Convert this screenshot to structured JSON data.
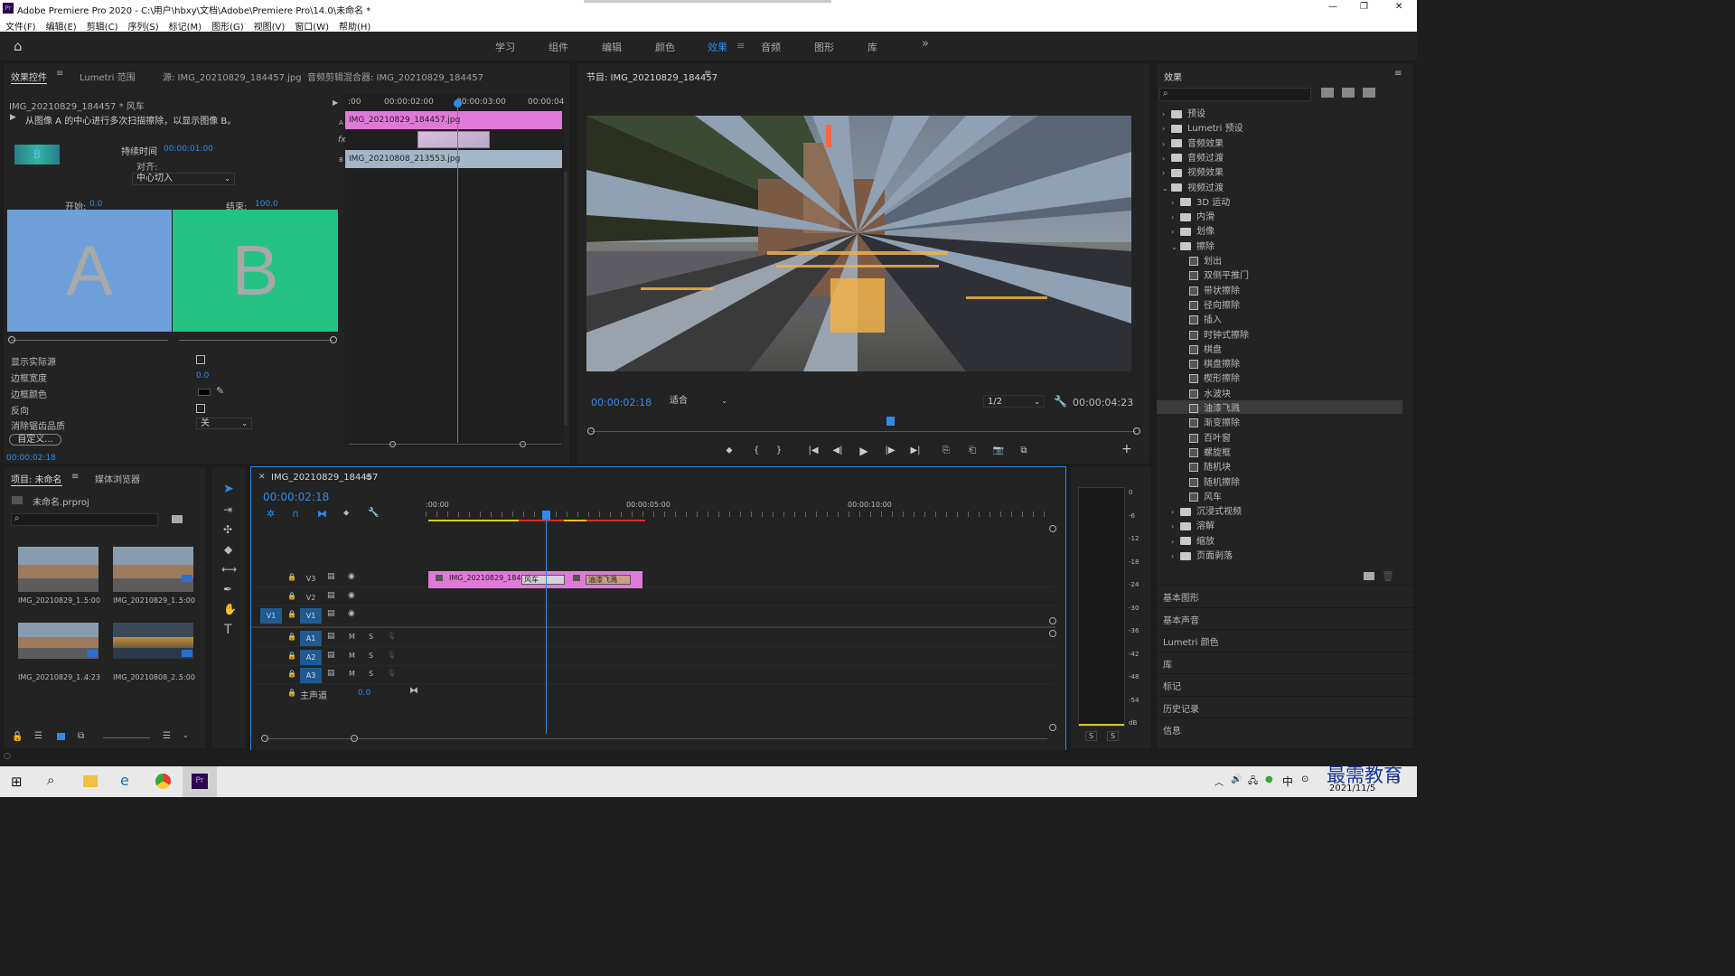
{
  "app": {
    "title": "Adobe Premiere Pro 2020 - C:\\用户\\hbxy\\文档\\Adobe\\Premiere Pro\\14.0\\未命名 *",
    "window_controls": [
      "—",
      "❐",
      "✕"
    ]
  },
  "menu": [
    "文件(F)",
    "编辑(E)",
    "剪辑(C)",
    "序列(S)",
    "标记(M)",
    "图形(G)",
    "视图(V)",
    "窗口(W)",
    "帮助(H)"
  ],
  "workspaces": {
    "tabs": [
      "学习",
      "组件",
      "编辑",
      "颜色",
      "效果",
      "音频",
      "图形",
      "库"
    ],
    "active": "效果",
    "more": "»"
  },
  "effect_controls": {
    "tabs": [
      "效果控件",
      "Lumetri 范围",
      "源: IMG_20210829_184457.jpg",
      "音频剪辑混合器: IMG_20210829_184457"
    ],
    "clip_label": "IMG_20210829_184457 * 风车",
    "description": "从图像 A 的中心进行多次扫描擦除，以显示图像 B。",
    "duration_label": "持续时间",
    "duration_value": "00:00:01:00",
    "align_label": "对齐:",
    "align_value": "中心切入",
    "start_label": "开始:",
    "start_value": "0.0",
    "end_label": "结束:",
    "end_value": "100.0",
    "preview_a": "A",
    "preview_b": "B",
    "thumb_label": "B",
    "props": [
      {
        "label": "显示实际源",
        "type": "checkbox"
      },
      {
        "label": "边框宽度",
        "value": "0.0"
      },
      {
        "label": "边框颜色",
        "type": "color"
      },
      {
        "label": "反向",
        "type": "checkbox"
      },
      {
        "label": "消除锯齿品质",
        "value": "关"
      }
    ],
    "custom_button": "自定义...",
    "timecode": "00:00:02:18",
    "mini_timeline": {
      "ruler": [
        ":00",
        "00:00:02:00",
        "00:00:03:00",
        "00:00:04"
      ],
      "clip_a": "IMG_20210829_184457.jpg",
      "clip_b": "IMG_20210808_213553.jpg",
      "track_a": "A",
      "track_b": "B",
      "fx": "fx"
    }
  },
  "program": {
    "title": "节目: IMG_20210829_184457",
    "timecode": "00:00:02:18",
    "fit": "适合",
    "resolution": "1/2",
    "duration": "00:00:04:23",
    "controls": [
      "⬥",
      "{",
      "}",
      "|◀",
      "◀|",
      "▶",
      "|▶",
      "▶|",
      "⎘",
      "⎗",
      "📷",
      "⧉"
    ],
    "add": "+"
  },
  "effects": {
    "title": "效果",
    "search_placeholder": "",
    "tree": [
      {
        "label": "预设",
        "kind": "folder",
        "level": 0,
        "caret": "›"
      },
      {
        "label": "Lumetri 预设",
        "kind": "folder",
        "level": 0,
        "caret": "›"
      },
      {
        "label": "音频效果",
        "kind": "folder",
        "level": 0,
        "caret": "›"
      },
      {
        "label": "音频过渡",
        "kind": "folder",
        "level": 0,
        "caret": "›"
      },
      {
        "label": "视频效果",
        "kind": "folder",
        "level": 0,
        "caret": "›"
      },
      {
        "label": "视频过渡",
        "kind": "folder",
        "level": 0,
        "caret": "⌄"
      },
      {
        "label": "3D 运动",
        "kind": "folder",
        "level": 1,
        "caret": "›"
      },
      {
        "label": "内滑",
        "kind": "folder",
        "level": 1,
        "caret": "›"
      },
      {
        "label": "划像",
        "kind": "folder",
        "level": 1,
        "caret": "›"
      },
      {
        "label": "擦除",
        "kind": "folder",
        "level": 1,
        "caret": "⌄"
      },
      {
        "label": "划出",
        "kind": "fx",
        "level": 2
      },
      {
        "label": "双侧平推门",
        "kind": "fx",
        "level": 2
      },
      {
        "label": "带状擦除",
        "kind": "fx",
        "level": 2
      },
      {
        "label": "径向擦除",
        "kind": "fx",
        "level": 2
      },
      {
        "label": "插入",
        "kind": "fx",
        "level": 2
      },
      {
        "label": "时钟式擦除",
        "kind": "fx",
        "level": 2
      },
      {
        "label": "棋盘",
        "kind": "fx",
        "level": 2
      },
      {
        "label": "棋盘擦除",
        "kind": "fx",
        "level": 2
      },
      {
        "label": "楔形擦除",
        "kind": "fx",
        "level": 2
      },
      {
        "label": "水波块",
        "kind": "fx",
        "level": 2
      },
      {
        "label": "油漆飞溅",
        "kind": "fx",
        "level": 2,
        "selected": true
      },
      {
        "label": "渐变擦除",
        "kind": "fx",
        "level": 2
      },
      {
        "label": "百叶窗",
        "kind": "fx",
        "level": 2
      },
      {
        "label": "螺旋框",
        "kind": "fx",
        "level": 2
      },
      {
        "label": "随机块",
        "kind": "fx",
        "level": 2
      },
      {
        "label": "随机擦除",
        "kind": "fx",
        "level": 2
      },
      {
        "label": "风车",
        "kind": "fx",
        "level": 2
      },
      {
        "label": "沉浸式视频",
        "kind": "folder",
        "level": 1,
        "caret": "›"
      },
      {
        "label": "溶解",
        "kind": "folder",
        "level": 1,
        "caret": "›"
      },
      {
        "label": "缩放",
        "kind": "folder",
        "level": 1,
        "caret": "›"
      },
      {
        "label": "页面剥落",
        "kind": "folder",
        "level": 1,
        "caret": "›"
      }
    ],
    "collapsed_panels": [
      "基本图形",
      "基本声音",
      "Lumetri 颜色",
      "库",
      "标记",
      "历史记录",
      "信息"
    ]
  },
  "project": {
    "tabs": [
      "项目: 未命名",
      "媒体浏览器"
    ],
    "file": "未命名.prproj",
    "items": [
      {
        "name": "IMG_20210829_1...",
        "dur": "5:00"
      },
      {
        "name": "IMG_20210829_1...",
        "dur": "5:00"
      },
      {
        "name": "IMG_20210829_1...",
        "dur": "4:23"
      },
      {
        "name": "IMG_20210808_2...",
        "dur": "5:00"
      }
    ]
  },
  "timeline": {
    "seq_name": "IMG_20210829_184457",
    "timecode": "00:00:02:18",
    "ruler": [
      ":00:00",
      "00:00:05:00",
      "00:00:10:00"
    ],
    "video_tracks": [
      "V3",
      "V2",
      "V1"
    ],
    "audio_tracks": [
      "A1",
      "A2",
      "A3"
    ],
    "master": "主声道",
    "master_value": "0.0",
    "clip_name": "IMG_20210829_18445",
    "transition_1": "风车",
    "transition_2": "油漆飞溅",
    "ms_labels": [
      "M",
      "S"
    ]
  },
  "meter": {
    "scale": [
      "0",
      "-6",
      "-12",
      "-18",
      "-24",
      "-30",
      "-36",
      "-42",
      "-48",
      "-54",
      "dB"
    ],
    "solo": [
      "S",
      "S"
    ]
  },
  "taskbar": {
    "ime": "中",
    "date": "2021/11/5",
    "watermark": "最需教育"
  },
  "colors": {
    "accent": "#2d8ceb",
    "clip_pink": "#e07ad8",
    "preview_a": "#6f9fd8",
    "preview_b": "#25c286"
  }
}
